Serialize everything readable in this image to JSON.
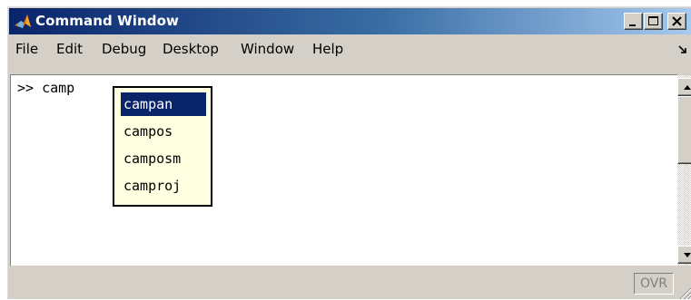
{
  "window": {
    "title": "Command Window",
    "icon": "matlab-icon",
    "controls": [
      "minimize-icon",
      "maximize-icon",
      "close-icon"
    ]
  },
  "menu": {
    "items": [
      "File",
      "Edit",
      "Debug",
      "Desktop",
      "Window",
      "Help"
    ],
    "undock_icon": "undock-arrow-icon"
  },
  "console": {
    "prompt": ">>",
    "input": "camp"
  },
  "completion": {
    "items": [
      "campan",
      "campos",
      "camposm",
      "camproj"
    ],
    "selected": "campan"
  },
  "status": {
    "indicator": "OVR"
  },
  "colors": {
    "title_bar_start": "#0a246a",
    "title_bar_end": "#a6caf0",
    "selection": "#0a246a",
    "popup_background": "#ffffe1",
    "window_face": "#d4d0c8"
  }
}
